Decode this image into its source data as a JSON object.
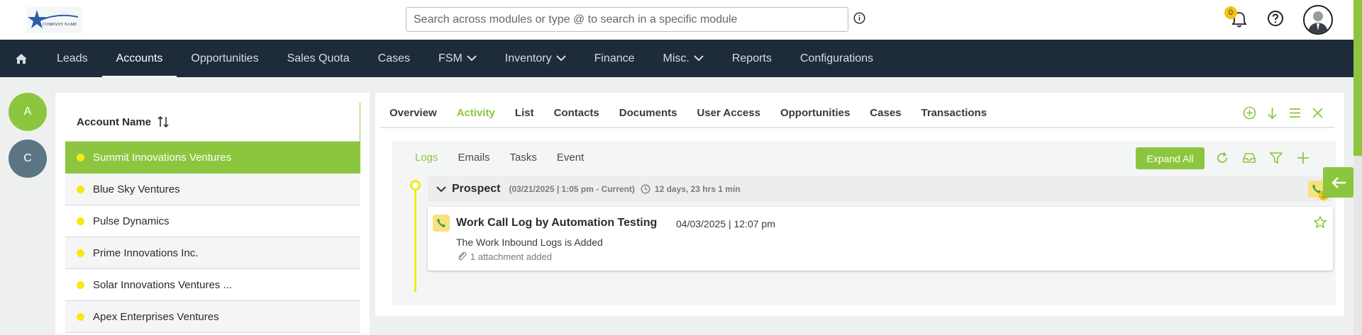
{
  "header": {
    "logo_text": "COMPANY NAME",
    "search_placeholder": "Search across modules or type @ to search in a specific module",
    "notifications_count": "0"
  },
  "nav": {
    "items": [
      {
        "label": "Leads"
      },
      {
        "label": "Accounts",
        "active": true
      },
      {
        "label": "Opportunities"
      },
      {
        "label": "Sales Quota"
      },
      {
        "label": "Cases"
      },
      {
        "label": "FSM",
        "dropdown": true
      },
      {
        "label": "Inventory",
        "dropdown": true
      },
      {
        "label": "Finance"
      },
      {
        "label": "Misc.",
        "dropdown": true
      },
      {
        "label": "Reports"
      },
      {
        "label": "Configurations"
      }
    ]
  },
  "letters": [
    "A",
    "C"
  ],
  "accounts": {
    "header": "Account Name",
    "rows": [
      "Summit Innovations Ventures",
      "Blue Sky Ventures",
      "Pulse Dynamics",
      "Prime Innovations Inc.",
      "Solar Innovations Ventures ...",
      "Apex Enterprises Ventures"
    ],
    "selected_index": 0
  },
  "detail_tabs": [
    "Overview",
    "Activity",
    "List",
    "Contacts",
    "Documents",
    "User Access",
    "Opportunities",
    "Cases",
    "Transactions"
  ],
  "activity": {
    "subtabs": [
      "Logs",
      "Emails",
      "Tasks",
      "Event"
    ],
    "expand_all": "Expand All",
    "stage": {
      "title": "Prospect",
      "dates": "(03/21/2025 | 1:05 pm - Current)",
      "duration": "12 days, 23 hrs 1 min",
      "call_count": "1"
    },
    "log": {
      "title": "Work Call Log by Automation Testing",
      "time": "04/03/2025 | 12:07 pm",
      "description": "The Work Inbound Logs is Added",
      "attachment": "1 attachment added"
    }
  },
  "colors": {
    "accent": "#8cc63f",
    "nav_bg": "#1d2b3a",
    "status_dot": "#f2ea18",
    "badge": "#f2c40f"
  }
}
